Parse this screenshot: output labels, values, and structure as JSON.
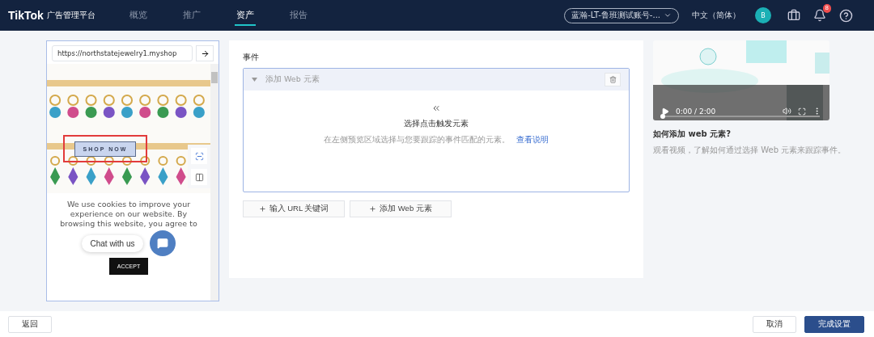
{
  "header": {
    "logo": "TikTok",
    "logo_suffix": "广告管理平台",
    "nav": [
      {
        "label": "概览",
        "selected": false
      },
      {
        "label": "推广",
        "selected": false
      },
      {
        "label": "资产",
        "selected": true
      },
      {
        "label": "报告",
        "selected": false
      }
    ],
    "account": "蓝瀚-LT-鲁班测试账号-...",
    "language": "中文（简体）",
    "avatar": "B",
    "notifications": "8"
  },
  "preview": {
    "url": "https://northstatejewelry1.myshop",
    "cta": "SHOP NOW",
    "cookie_text": "We use cookies to improve your experience on our website. By browsing this website, you agree to",
    "chat": "Chat with us",
    "accept": "ACCEPT"
  },
  "events": {
    "title": "事件",
    "panel": {
      "title": "添加 Web 元素",
      "expanded": true,
      "heading": "选择点击触发元素",
      "description": "在左侧预览区域选择与您要跟踪的事件匹配的元素。",
      "link": "查看说明"
    },
    "buttons": [
      "输入 URL 关键词",
      "添加 Web 元素"
    ]
  },
  "video": {
    "time": "0:00 / 2:00",
    "level": 0,
    "title": "如何添加 web 元素?",
    "description": "观看视频，了解如何通过选择 Web 元素来跟踪事件。"
  },
  "footer": {
    "back": "返回",
    "cancel": "取消",
    "done": "完成设置"
  }
}
